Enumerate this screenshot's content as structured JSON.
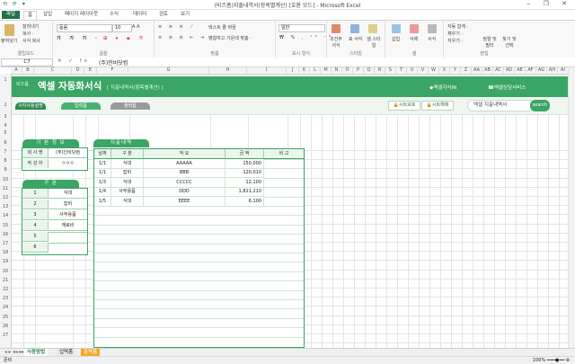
{
  "window": {
    "title": "(비즈폼)지출내역서(항목별계산) [호환 모드] - Microsoft Excel",
    "qat": "⟲ ⟳ ▾"
  },
  "ribbon": {
    "tabs": [
      "파일",
      "홈",
      "삽입",
      "페이지 레이아웃",
      "수식",
      "데이터",
      "검토",
      "보기"
    ],
    "clipboard": {
      "paste": "붙여넣기",
      "cut": "잘라내기",
      "copy": "복사 ·",
      "format_painter": "서식 복사",
      "label": "클립보드"
    },
    "font": {
      "name": "돋움",
      "size": "10",
      "label": "글꼴"
    },
    "alignment": {
      "wrap": "텍스트 줄 바꿈",
      "merge": "병합하고 가운데 맞춤 ·",
      "label": "맞춤"
    },
    "number": {
      "format": "일반",
      "label": "표시 형식"
    },
    "styles": {
      "cond": "조건부 서식",
      "table": "표 서식",
      "cell": "셀 스타일",
      "label": "스타일"
    },
    "cells": {
      "insert": "삽입",
      "delete": "삭제",
      "format": "서식",
      "label": "셀"
    },
    "editing": {
      "autosum": "자동 합계 ·",
      "fill": "채우기 ·",
      "clear": "지우기 ·",
      "sort": "정렬 및 필터",
      "find": "찾기 및 선택",
      "label": "편집"
    }
  },
  "formula_bar": {
    "name_box": "C7",
    "fx": "✕ ✓ fx",
    "value": "(주)인비닷컴"
  },
  "columns": [
    "A",
    "B",
    "C",
    "D",
    "E",
    "F",
    "G",
    "H",
    "I",
    "J",
    "K",
    "L",
    "M",
    "N",
    "O",
    "P",
    "Q",
    "R",
    "S",
    "T",
    "U",
    "V",
    "W",
    "X",
    "Y",
    "Z",
    "AA",
    "AB",
    "AC",
    "AD",
    "AE",
    "AF",
    "AG",
    "AH",
    "AI",
    "AJ",
    "AK"
  ],
  "rows": [
    "1",
    "2",
    "3",
    "4",
    "5",
    "6",
    "7",
    "8",
    "9",
    "10",
    "11",
    "12",
    "13",
    "14",
    "15",
    "16",
    "17",
    "18",
    "19",
    "20",
    "21",
    "22",
    "23",
    "24",
    "25",
    "26",
    "27",
    "28",
    "29",
    "30",
    "31",
    "32",
    "33",
    "34",
    "35",
    "36"
  ],
  "banner": {
    "badge": "비즈폼",
    "title": "엑셀 자동화서식",
    "subtitle": "[ 지출내역서(항목별계산) ]",
    "link_site": "◆엑셀지식IN",
    "link_service": "☎엑셀상담서비스"
  },
  "toolbar": {
    "tabs": [
      "사지사용설명",
      "입력폼",
      "출력폼"
    ],
    "protect": "🔒시트보호",
    "unprotect": "🔒시트해제",
    "search_placeholder": "엑셀 지출내역서",
    "search_btn": "search"
  },
  "basic_info": {
    "title": "기 본 정 보",
    "rows": [
      {
        "label": "회 사 명",
        "value": "(주)인비닷컴"
      },
      {
        "label": "작 성 자",
        "value": "ㅇㅇㅇ"
      }
    ]
  },
  "category": {
    "title": "구   분",
    "rows": [
      {
        "no": "1",
        "name": "식대"
      },
      {
        "no": "2",
        "name": "잡비"
      },
      {
        "no": "3",
        "name": "사무용품"
      },
      {
        "no": "4",
        "name": "재료비"
      },
      {
        "no": "5",
        "name": ""
      },
      {
        "no": "6",
        "name": ""
      }
    ]
  },
  "expenses": {
    "title": "지출내역",
    "headers": [
      "날짜",
      "구 분",
      "적   요",
      "금   액",
      "비   고"
    ],
    "rows": [
      {
        "date": "1/1",
        "cat": "식대",
        "desc": "AAAAA",
        "amount": "150,000",
        "note": ""
      },
      {
        "date": "1/1",
        "cat": "잡비",
        "desc": "BBB",
        "amount": "120,010",
        "note": ""
      },
      {
        "date": "1/3",
        "cat": "식대",
        "desc": "CCCCC",
        "amount": "12,100",
        "note": ""
      },
      {
        "date": "1/4",
        "cat": "사무용품",
        "desc": "DDD",
        "amount": "1,811,210",
        "note": ""
      },
      {
        "date": "1/5",
        "cat": "식대",
        "desc": "EEEE",
        "amount": "6,100",
        "note": ""
      }
    ]
  },
  "sheet_tabs": {
    "nav": "◂ ▸ ◂◂ ▸▸",
    "tabs": [
      "사용방법",
      "입력폼",
      "출력폼"
    ]
  },
  "status": {
    "ready": "준비",
    "zoom": "100%  ━━━●━━  ⊕"
  },
  "colors": {
    "accent": "#3aa564",
    "excel": "#217346"
  }
}
